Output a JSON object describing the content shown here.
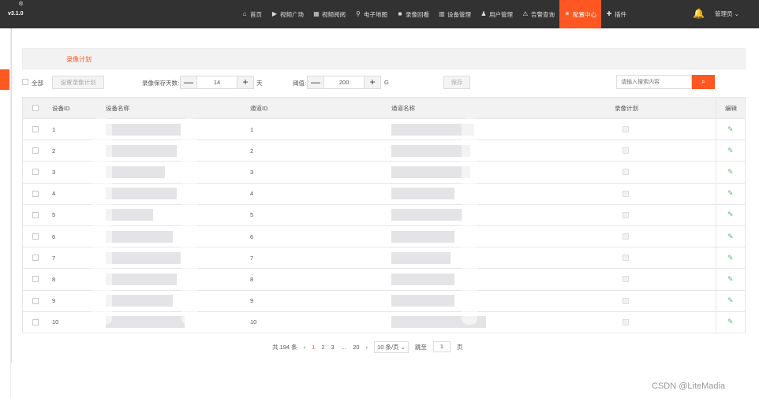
{
  "brand": {
    "version": "v3.1.0",
    "reg": "®"
  },
  "nav": [
    {
      "label": "首页",
      "icon": "home-icon",
      "glyph": "⌂"
    },
    {
      "label": "视频广场",
      "icon": "play-icon",
      "glyph": "▶"
    },
    {
      "label": "视频阅阅",
      "icon": "grid-icon",
      "glyph": "▦"
    },
    {
      "label": "电子地图",
      "icon": "map-pin-icon",
      "glyph": "⚲"
    },
    {
      "label": "录像回看",
      "icon": "camera-icon",
      "glyph": "■"
    },
    {
      "label": "设备管理",
      "icon": "device-icon",
      "glyph": "▥"
    },
    {
      "label": "用户管理",
      "icon": "user-icon",
      "glyph": "♟"
    },
    {
      "label": "告警查询",
      "icon": "alarm-icon",
      "glyph": "⚠"
    },
    {
      "label": "配置中心",
      "icon": "gear-icon",
      "glyph": "✷",
      "active": true
    },
    {
      "label": "插件",
      "icon": "puzzle-icon",
      "glyph": "✚"
    }
  ],
  "user": {
    "name": "管理员 ⌄"
  },
  "card": {
    "title": "录像计划"
  },
  "toolbar": {
    "all_label": "全部",
    "plan_button": "设置录像计划",
    "days_label": "录像保存天数:",
    "days_value": "14",
    "days_unit": "天",
    "threshold_label": "阈值:",
    "threshold_value": "200",
    "threshold_unit": "G",
    "save_button": "保存",
    "search_placeholder": "请输入搜索内容",
    "minus": "—",
    "plus": "+"
  },
  "table": {
    "headers": [
      "设备ID",
      "设备名称",
      "通道ID",
      "通道名称",
      "录像计划",
      "编辑"
    ],
    "rows": [
      {
        "id": "1",
        "channel_id": "1"
      },
      {
        "id": "2",
        "channel_id": "2"
      },
      {
        "id": "3",
        "channel_id": "3"
      },
      {
        "id": "4",
        "channel_id": "4"
      },
      {
        "id": "5",
        "channel_id": "5"
      },
      {
        "id": "6",
        "channel_id": "6"
      },
      {
        "id": "7",
        "channel_id": "7"
      },
      {
        "id": "8",
        "channel_id": "8"
      },
      {
        "id": "9",
        "channel_id": "9"
      },
      {
        "id": "10",
        "channel_id": "10"
      }
    ]
  },
  "pager": {
    "total": "共 194 条",
    "prev": "‹",
    "pages": [
      "1",
      "2",
      "3",
      "…",
      "20"
    ],
    "next": "›",
    "page_size": "10 条/页 ⌄",
    "goto_label": "跳至",
    "goto_value": "1",
    "goto_unit": "页"
  },
  "watermark": "CSDN @LiteMadia",
  "colors": {
    "accent": "#ff5722",
    "topbar": "#323232",
    "edit": "#5fb878"
  }
}
